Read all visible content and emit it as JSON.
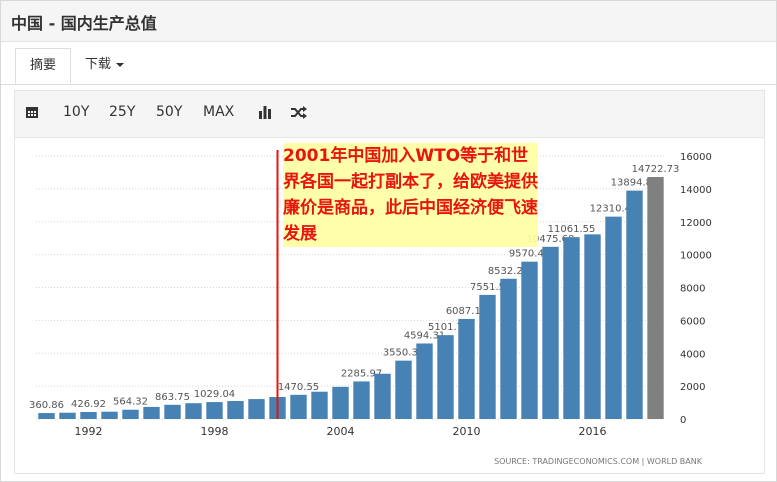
{
  "header": {
    "title": "中国 - 国内生产总值"
  },
  "tabs": {
    "summary": "摘要",
    "download": "下载"
  },
  "toolbar": {
    "calendar_icon": "calendar-icon",
    "range_10y": "10Y",
    "range_25y": "25Y",
    "range_50y": "50Y",
    "range_max": "MAX",
    "bar_icon": "bar-chart-icon",
    "shuffle_icon": "shuffle-icon"
  },
  "annotation": {
    "text": "2001年中国加入WTO等于和世界各国一起打副本了，给欧美提供廉价是商品，此后中国经济便飞速发展"
  },
  "source": "SOURCE: TRADINGECONOMICS.COM | WORLD BANK",
  "colors": {
    "bar": "#4682b4",
    "last_bar": "#808080",
    "annotation": "#e8140f",
    "marker_line": "#e8140f"
  },
  "chart_data": {
    "type": "bar",
    "categories": [
      "1990",
      "1991",
      "1992",
      "1993",
      "1994",
      "1995",
      "1996",
      "1997",
      "1998",
      "1999",
      "2000",
      "2001",
      "2002",
      "2003",
      "2004",
      "2005",
      "2006",
      "2007",
      "2008",
      "2009",
      "2010",
      "2011",
      "2012",
      "2013",
      "2014",
      "2015",
      "2016",
      "2017",
      "2018",
      "2019"
    ],
    "values": [
      360.86,
      383.37,
      426.92,
      444.73,
      564.32,
      734.55,
      863.75,
      961.6,
      1029.04,
      1094.0,
      1211.35,
      1339.4,
      1470.55,
      1660.29,
      1955.35,
      2285.97,
      2752.13,
      3550.34,
      4594.31,
      5101.7,
      6087.16,
      7551.5,
      8532.23,
      9570.41,
      10475.68,
      11061.55,
      11233.28,
      12310.41,
      13894.82,
      14722.73
    ],
    "labels": [
      "360.86",
      "",
      "426.92",
      "",
      "564.32",
      "",
      "863.75",
      "",
      "1029.04",
      "",
      "",
      "",
      "1470.55",
      "",
      "",
      "2285.97",
      "",
      "3550.34",
      "4594.31",
      "5101.7",
      "6087.16",
      "7551.5",
      "8532.23",
      "9570.41",
      "10475.68",
      "11061.55",
      "",
      "12310.41",
      "13894.82",
      "14722.73"
    ],
    "xticks": [
      "1992",
      "1998",
      "2004",
      "2010",
      "2016"
    ],
    "yticks": [
      "0",
      "2000",
      "4000",
      "6000",
      "8000",
      "10000",
      "12000",
      "14000",
      "16000"
    ],
    "ylim": [
      0,
      16000
    ],
    "grid": true,
    "event_marker": "2001"
  }
}
